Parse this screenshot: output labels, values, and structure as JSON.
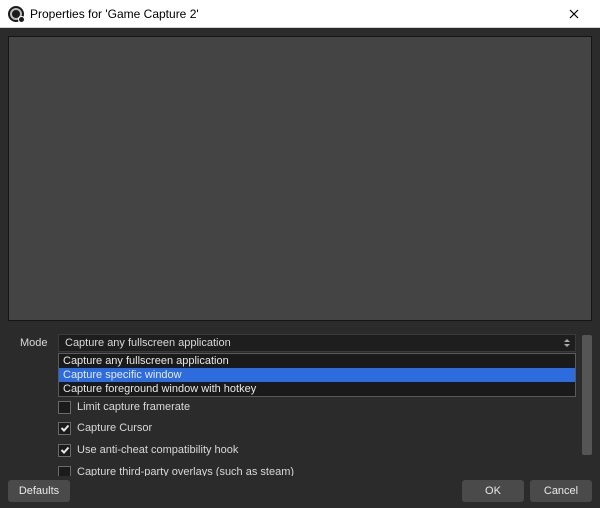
{
  "window": {
    "title": "Properties for 'Game Capture 2'"
  },
  "mode": {
    "label": "Mode",
    "selected": "Capture any fullscreen application",
    "options": [
      "Capture any fullscreen application",
      "Capture specific window",
      "Capture foreground window with hotkey"
    ],
    "highlighted_index": 1
  },
  "checks": {
    "limit_framerate": {
      "label": "Limit capture framerate",
      "checked": false
    },
    "capture_cursor": {
      "label": "Capture Cursor",
      "checked": true
    },
    "anti_cheat_hook": {
      "label": "Use anti-cheat compatibility hook",
      "checked": true
    },
    "third_party_overlays": {
      "label": "Capture third-party overlays (such as steam)",
      "checked": false
    }
  },
  "buttons": {
    "defaults": "Defaults",
    "ok": "OK",
    "cancel": "Cancel"
  }
}
